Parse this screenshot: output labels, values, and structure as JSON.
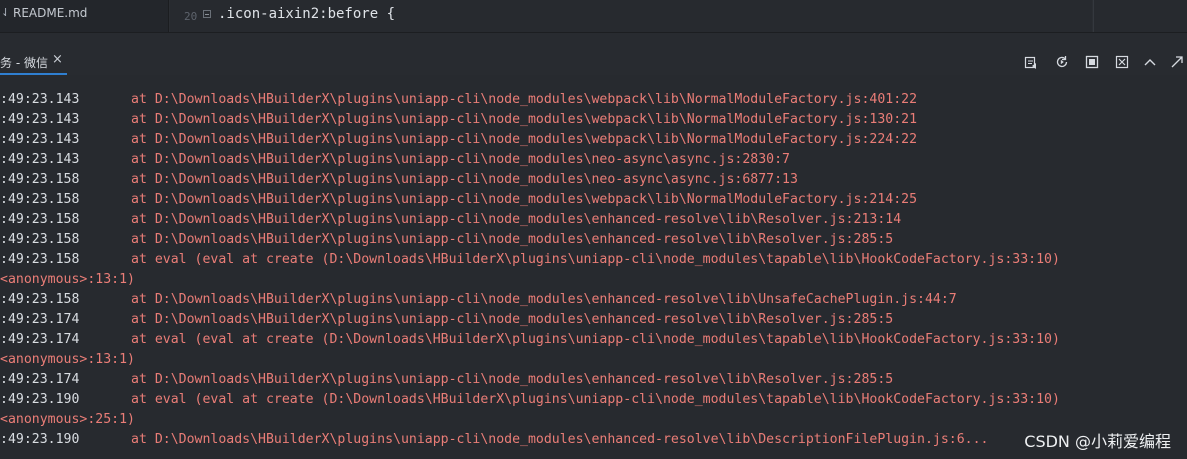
{
  "editor": {
    "file_tab": {
      "arrow": "⇃",
      "name": "README.md"
    },
    "line_number": "20",
    "code": ".icon-aixin2:before {"
  },
  "console": {
    "tab_title": "务 - 微信",
    "close_label": "×",
    "toolbar": [
      "copy-log-icon",
      "restart-icon",
      "stop-icon",
      "clear-icon",
      "collapse-icon",
      "maximize-icon"
    ]
  },
  "log": [
    {
      "type": "entry",
      "ts": ":49:23.143",
      "msg": "at D:\\Downloads\\HBuilderX\\plugins\\uniapp-cli\\node_modules\\webpack\\lib\\NormalModuleFactory.js:401:22"
    },
    {
      "type": "entry",
      "ts": ":49:23.143",
      "msg": "at D:\\Downloads\\HBuilderX\\plugins\\uniapp-cli\\node_modules\\webpack\\lib\\NormalModuleFactory.js:130:21"
    },
    {
      "type": "entry",
      "ts": ":49:23.143",
      "msg": "at D:\\Downloads\\HBuilderX\\plugins\\uniapp-cli\\node_modules\\webpack\\lib\\NormalModuleFactory.js:224:22"
    },
    {
      "type": "entry",
      "ts": ":49:23.143",
      "msg": "at D:\\Downloads\\HBuilderX\\plugins\\uniapp-cli\\node_modules\\neo-async\\async.js:2830:7"
    },
    {
      "type": "entry",
      "ts": ":49:23.158",
      "msg": "at D:\\Downloads\\HBuilderX\\plugins\\uniapp-cli\\node_modules\\neo-async\\async.js:6877:13"
    },
    {
      "type": "entry",
      "ts": ":49:23.158",
      "msg": "at D:\\Downloads\\HBuilderX\\plugins\\uniapp-cli\\node_modules\\webpack\\lib\\NormalModuleFactory.js:214:25"
    },
    {
      "type": "entry",
      "ts": ":49:23.158",
      "msg": "at D:\\Downloads\\HBuilderX\\plugins\\uniapp-cli\\node_modules\\enhanced-resolve\\lib\\Resolver.js:213:14"
    },
    {
      "type": "entry",
      "ts": ":49:23.158",
      "msg": "at D:\\Downloads\\HBuilderX\\plugins\\uniapp-cli\\node_modules\\enhanced-resolve\\lib\\Resolver.js:285:5"
    },
    {
      "type": "entry",
      "ts": ":49:23.158",
      "msg": "at eval (eval at create (D:\\Downloads\\HBuilderX\\plugins\\uniapp-cli\\node_modules\\tapable\\lib\\HookCodeFactory.js:33:10)"
    },
    {
      "type": "cont",
      "msg": "<anonymous>:13:1)"
    },
    {
      "type": "entry",
      "ts": ":49:23.158",
      "msg": "at D:\\Downloads\\HBuilderX\\plugins\\uniapp-cli\\node_modules\\enhanced-resolve\\lib\\UnsafeCachePlugin.js:44:7"
    },
    {
      "type": "entry",
      "ts": ":49:23.174",
      "msg": "at D:\\Downloads\\HBuilderX\\plugins\\uniapp-cli\\node_modules\\enhanced-resolve\\lib\\Resolver.js:285:5"
    },
    {
      "type": "entry",
      "ts": ":49:23.174",
      "msg": "at eval (eval at create (D:\\Downloads\\HBuilderX\\plugins\\uniapp-cli\\node_modules\\tapable\\lib\\HookCodeFactory.js:33:10)"
    },
    {
      "type": "cont",
      "msg": "<anonymous>:13:1)"
    },
    {
      "type": "entry",
      "ts": ":49:23.174",
      "msg": "at D:\\Downloads\\HBuilderX\\plugins\\uniapp-cli\\node_modules\\enhanced-resolve\\lib\\Resolver.js:285:5"
    },
    {
      "type": "entry",
      "ts": ":49:23.190",
      "msg": "at eval (eval at create (D:\\Downloads\\HBuilderX\\plugins\\uniapp-cli\\node_modules\\tapable\\lib\\HookCodeFactory.js:33:10)"
    },
    {
      "type": "cont",
      "msg": "<anonymous>:25:1)"
    },
    {
      "type": "entry",
      "ts": ":49:23.190",
      "msg": "at D:\\Downloads\\HBuilderX\\plugins\\uniapp-cli\\node_modules\\enhanced-resolve\\lib\\DescriptionFilePlugin.js:6..."
    }
  ],
  "watermark": "CSDN @小莉爱编程",
  "colors": {
    "background": "#272a2f",
    "log_message": "#ea7d77",
    "timestamp": "#d9dde2",
    "tab_accent": "#2f7fd1"
  }
}
